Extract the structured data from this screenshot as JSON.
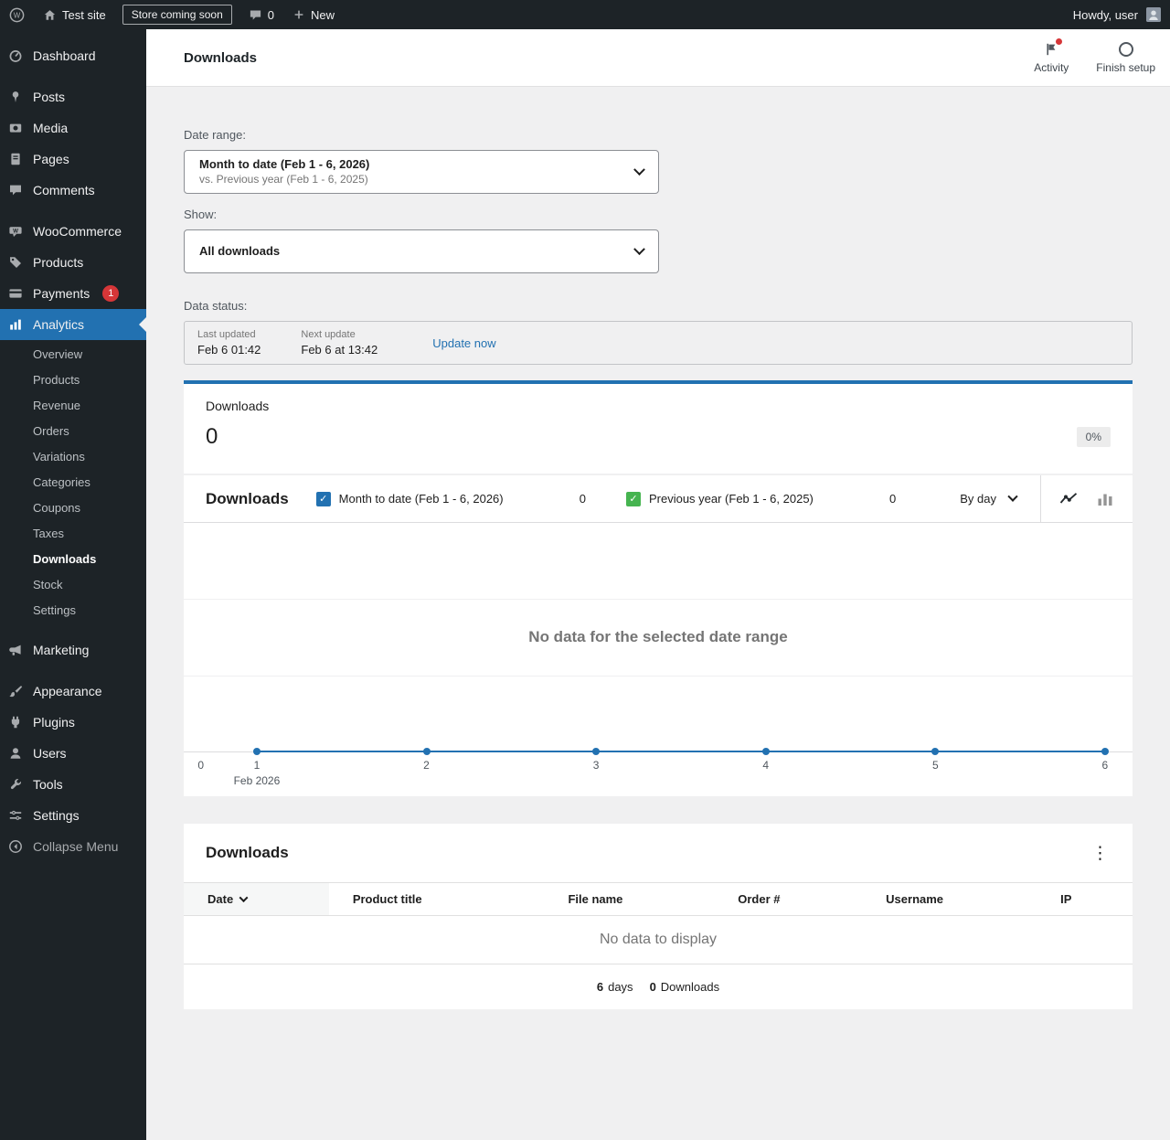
{
  "admin_bar": {
    "site_name": "Test site",
    "coming_soon_badge": "Store coming soon",
    "comments_count": "0",
    "new_label": "New",
    "howdy_text": "Howdy, user"
  },
  "sidebar": {
    "items": [
      {
        "label": "Dashboard"
      },
      {
        "label": "Posts"
      },
      {
        "label": "Media"
      },
      {
        "label": "Pages"
      },
      {
        "label": "Comments"
      },
      {
        "label": "WooCommerce"
      },
      {
        "label": "Products"
      },
      {
        "label": "Payments",
        "badge": "1"
      },
      {
        "label": "Analytics"
      },
      {
        "label": "Marketing"
      },
      {
        "label": "Appearance"
      },
      {
        "label": "Plugins"
      },
      {
        "label": "Users"
      },
      {
        "label": "Tools"
      },
      {
        "label": "Settings"
      },
      {
        "label": "Collapse Menu"
      }
    ],
    "analytics_submenu": [
      "Overview",
      "Products",
      "Revenue",
      "Orders",
      "Variations",
      "Categories",
      "Coupons",
      "Taxes",
      "Downloads",
      "Stock",
      "Settings"
    ]
  },
  "header": {
    "title": "Downloads",
    "activity_label": "Activity",
    "finish_setup_label": "Finish setup"
  },
  "filters": {
    "date_range_label": "Date range:",
    "date_range_primary": "Month to date (Feb 1 - 6, 2026)",
    "date_range_secondary": "vs. Previous year (Feb 1 - 6, 2025)",
    "show_label": "Show:",
    "show_value": "All downloads"
  },
  "data_status": {
    "label": "Data status:",
    "last_updated_label": "Last updated",
    "last_updated_value": "Feb 6 01:42",
    "next_update_label": "Next update",
    "next_update_value": "Feb 6 at 13:42",
    "update_link": "Update now"
  },
  "summary": {
    "label": "Downloads",
    "value": "0",
    "delta": "0%"
  },
  "chart": {
    "title": "Downloads",
    "interval_label": "By day",
    "legend": [
      {
        "label": "Month to date (Feb 1 - 6, 2026)",
        "value": "0",
        "color": "#2271b1"
      },
      {
        "label": "Previous year (Feb 1 - 6, 2025)",
        "value": "0",
        "color": "#46b450"
      }
    ],
    "empty_message": "No data for the selected date range",
    "y_zero_label": "0",
    "x_ticks": [
      "1",
      "2",
      "3",
      "4",
      "5",
      "6"
    ],
    "x_axis_sublabel": "Feb 2026"
  },
  "chart_data": {
    "type": "line",
    "x": [
      1,
      2,
      3,
      4,
      5,
      6
    ],
    "series": [
      {
        "name": "Month to date (Feb 1 - 6, 2026)",
        "values": [
          0,
          0,
          0,
          0,
          0,
          0
        ]
      },
      {
        "name": "Previous year (Feb 1 - 6, 2025)",
        "values": [
          0,
          0,
          0,
          0,
          0,
          0
        ]
      }
    ],
    "title": "Downloads",
    "xlabel": "Feb 2026",
    "ylabel": "",
    "ylim": [
      0,
      1
    ],
    "legend_position": "top"
  },
  "table": {
    "title": "Downloads",
    "columns": [
      "Date",
      "Product title",
      "File name",
      "Order #",
      "Username",
      "IP"
    ],
    "empty_message": "No data to display",
    "summary_days_value": "6",
    "summary_days_label": "days",
    "summary_downloads_value": "0",
    "summary_downloads_label": "Downloads"
  },
  "icons": {
    "wp_letter": "W",
    "woo_letter": "W",
    "check": "✓",
    "kebab": "⋮"
  },
  "colors": {
    "accent": "#2271b1",
    "series_primary": "#2271b1",
    "series_secondary": "#46b450",
    "notification_red": "#d63638",
    "sidebar_bg": "#1d2327"
  }
}
